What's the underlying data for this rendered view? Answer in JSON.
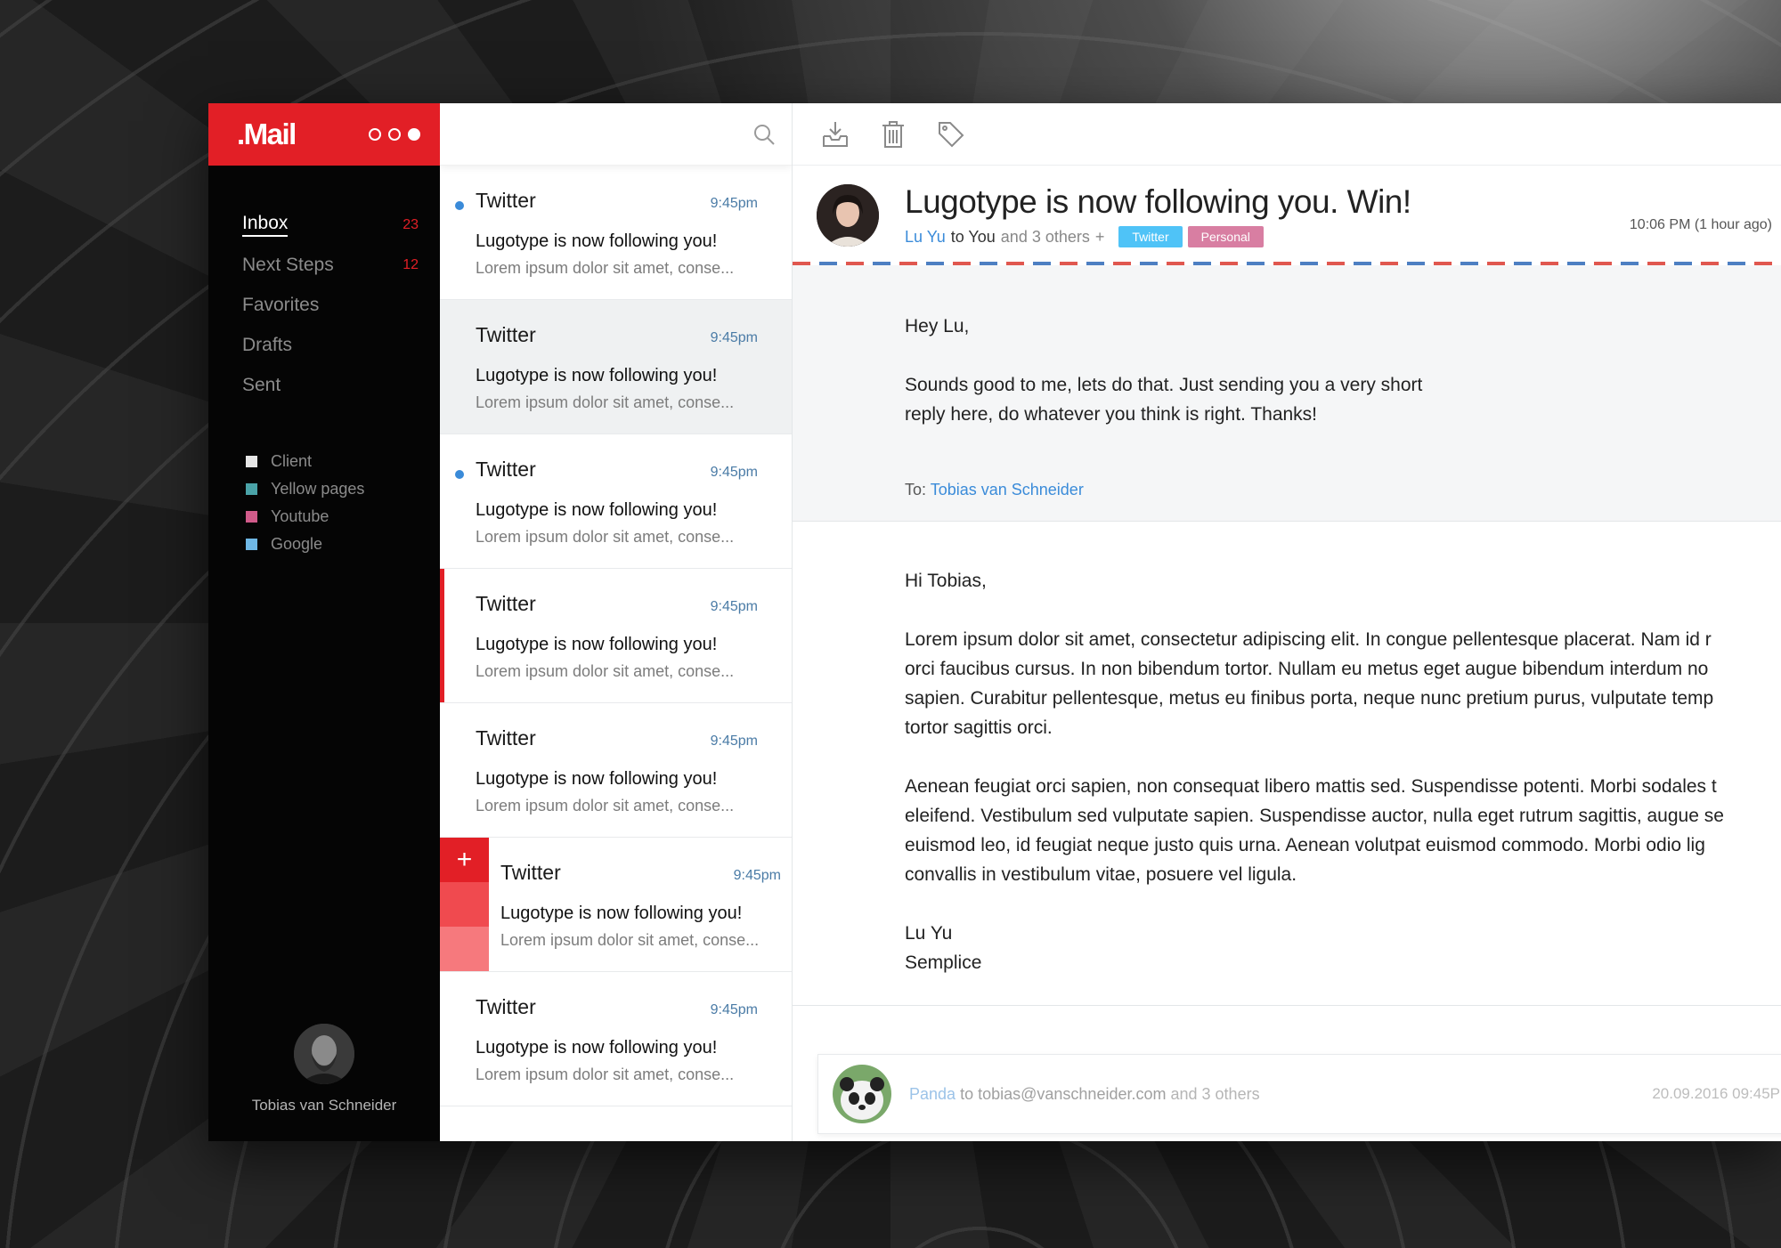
{
  "app": {
    "logo": ".Mail"
  },
  "sidebar": {
    "nav": [
      {
        "label": "Inbox",
        "count": "23"
      },
      {
        "label": "Next Steps",
        "count": "12"
      },
      {
        "label": "Favorites",
        "count": ""
      },
      {
        "label": "Drafts",
        "count": ""
      },
      {
        "label": "Sent",
        "count": ""
      }
    ],
    "labels": [
      {
        "label": "Client",
        "color": "#e6e6e6"
      },
      {
        "label": "Yellow pages",
        "color": "#4aa3a8"
      },
      {
        "label": "Youtube",
        "color": "#d15b8a"
      },
      {
        "label": "Google",
        "color": "#6fb8e6"
      }
    ],
    "user": {
      "name": "Tobias van Schneider"
    }
  },
  "list": {
    "search_icon": "search-icon",
    "items": [
      {
        "sender": "Twitter",
        "time": "9:45pm",
        "subject": "Lugotype is now following you!",
        "preview": "Lorem ipsum dolor sit amet, conse..."
      },
      {
        "sender": "Twitter",
        "time": "9:45pm",
        "subject": "Lugotype is now following you!",
        "preview": "Lorem ipsum dolor sit amet, conse..."
      },
      {
        "sender": "Twitter",
        "time": "9:45pm",
        "subject": "Lugotype is now following you!",
        "preview": "Lorem ipsum dolor sit amet, conse..."
      },
      {
        "sender": "Twitter",
        "time": "9:45pm",
        "subject": "Lugotype is now following you!",
        "preview": "Lorem ipsum dolor sit amet, conse..."
      },
      {
        "sender": "Twitter",
        "time": "9:45pm",
        "subject": "Lugotype is now following you!",
        "preview": "Lorem ipsum dolor sit amet, conse..."
      },
      {
        "sender": "Twitter",
        "time": "9:45pm",
        "subject": "Lugotype is now following you!",
        "preview": "Lorem ipsum dolor sit amet, conse...",
        "swipe_action": "+"
      },
      {
        "sender": "Twitter",
        "time": "9:45pm",
        "subject": "Lugotype is now following you!",
        "preview": "Lorem ipsum dolor sit amet, conse..."
      }
    ]
  },
  "reader": {
    "toolbar": [
      "archive-icon",
      "trash-icon",
      "tag-icon"
    ],
    "subject": "Lugotype is now following you. Win!",
    "from": "Lu Yu",
    "to_text": "to You",
    "others": "and 3 others",
    "add": "+",
    "tags": [
      "Twitter",
      "Personal"
    ],
    "timestamp": "10:06 PM (1 hour ago)",
    "quoted": {
      "greeting": "Hey Lu,",
      "line1": "Sounds good to me, lets do that. Just sending you a very short",
      "line2": "reply here, do whatever you think is right. Thanks!",
      "to_label": "To:",
      "to_name": "Tobias van Schneider"
    },
    "body": {
      "greeting": "Hi Tobias,",
      "p1": [
        "Lorem ipsum dolor sit amet, consectetur adipiscing elit. In congue pellentesque placerat. Nam id r",
        "orci faucibus cursus. In non bibendum tortor. Nullam eu metus eget augue bibendum interdum no",
        "sapien. Curabitur pellentesque, metus eu finibus porta, neque nunc pretium purus, vulputate temp",
        "tortor sagittis orci."
      ],
      "p2": [
        "Aenean feugiat orci sapien, non consequat libero mattis sed. Suspendisse potenti. Morbi sodales t",
        "eleifend. Vestibulum sed vulputate sapien. Suspendisse auctor, nulla eget rutrum sagittis, augue se",
        "euismod leo, id feugiat neque justo quis urna. Aenean volutpat euismod commodo. Morbi odio lig",
        "convallis in vestibulum vitae, posuere vel ligula."
      ],
      "sig1": "Lu Yu",
      "sig2": "Semplice"
    },
    "thread": {
      "from": "Panda",
      "to": "to tobias@vanschneider.com",
      "others": "and 3 others",
      "date": "20.09.2016  09:45P"
    }
  }
}
